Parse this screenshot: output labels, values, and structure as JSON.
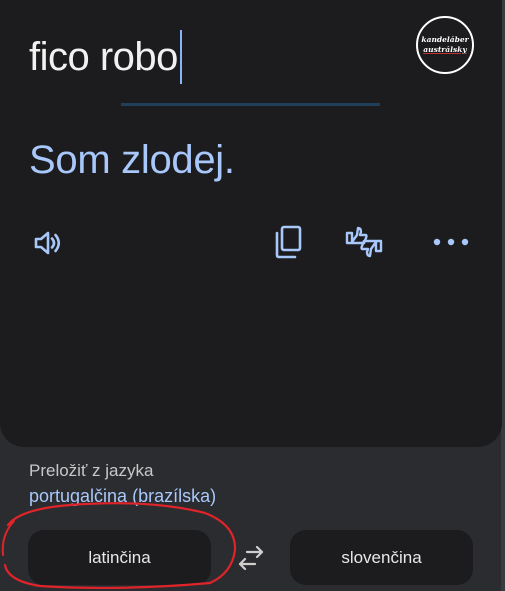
{
  "source": {
    "text": "fico robo"
  },
  "badge": {
    "line1": "kandeláber",
    "line2": "austrálsky"
  },
  "translation": {
    "text": "Som zlodej."
  },
  "actions": {
    "icons": [
      "speaker-icon",
      "copy-icon",
      "feedback-icon",
      "more-icon"
    ]
  },
  "language_panel": {
    "from_label": "Preložiť z jazyka",
    "detected_language": "portugalčina (brazílska)",
    "source_button": "latinčina",
    "target_button": "slovenčina"
  },
  "colors": {
    "background": "#2b2c2f",
    "card": "#1c1c1e",
    "accent": "#a8c7fa",
    "annotation": "#e0242a"
  }
}
